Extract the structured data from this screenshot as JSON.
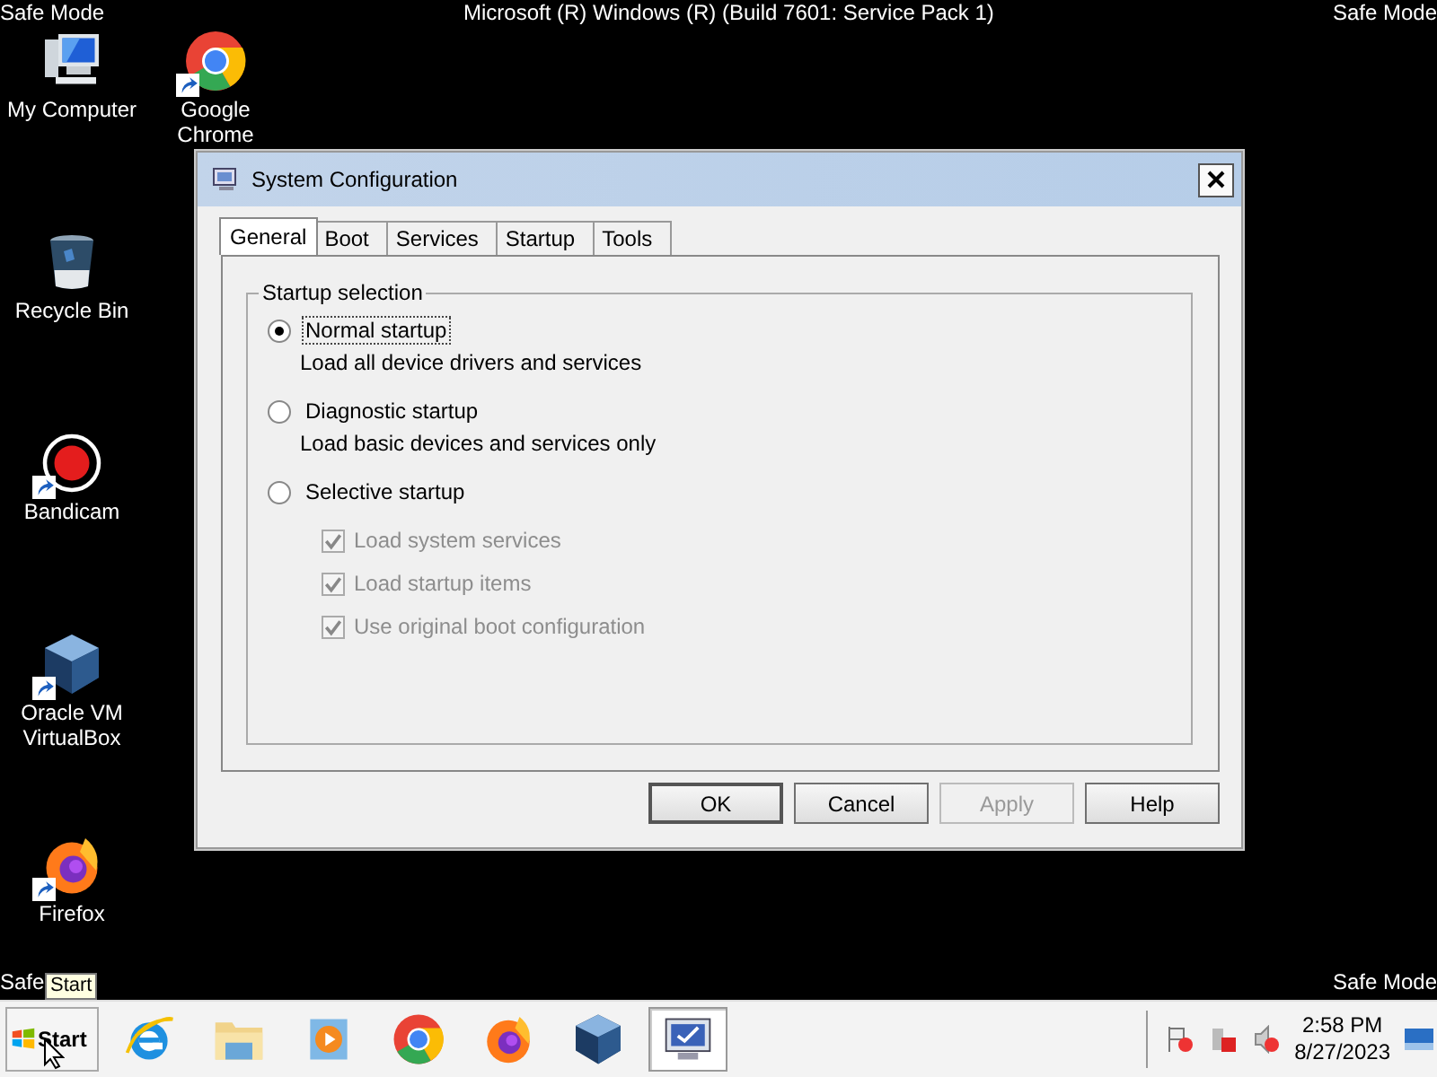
{
  "top_bar": {
    "left": "Safe Mode",
    "center": "Microsoft (R) Windows (R) (Build 7601: Service Pack 1)",
    "right": "Safe Mode"
  },
  "bottom_bar": {
    "left": "Safe",
    "right": "Safe Mode"
  },
  "desktop_icons": [
    {
      "label": "My Computer",
      "kind": "computer",
      "shortcut": false
    },
    {
      "label": "Recycle Bin",
      "kind": "bin",
      "shortcut": false
    },
    {
      "label": "Bandicam",
      "kind": "record",
      "shortcut": true
    },
    {
      "label": "Oracle VM VirtualBox",
      "kind": "cube",
      "shortcut": true
    },
    {
      "label": "Firefox",
      "kind": "firefox",
      "shortcut": true
    },
    {
      "label": "Google Chrome",
      "kind": "chrome",
      "shortcut": true
    }
  ],
  "dialog": {
    "title": "System Configuration",
    "tabs": [
      {
        "label": "General",
        "selected": true
      },
      {
        "label": "Boot",
        "selected": false
      },
      {
        "label": "Services",
        "selected": false
      },
      {
        "label": "Startup",
        "selected": false
      },
      {
        "label": "Tools",
        "selected": false
      }
    ],
    "group_label": "Startup selection",
    "options": [
      {
        "label": "Normal startup",
        "description": "Load all device drivers and services",
        "selected": true
      },
      {
        "label": "Diagnostic startup",
        "description": "Load basic devices and services only",
        "selected": false
      },
      {
        "label": "Selective startup",
        "selected": false
      }
    ],
    "suboptions": [
      {
        "label": "Load system services",
        "checked": true,
        "disabled": true
      },
      {
        "label": "Load startup items",
        "checked": true,
        "disabled": true
      },
      {
        "label": "Use original boot configuration",
        "checked": true,
        "disabled": true
      }
    ],
    "buttons": [
      {
        "label": "OK",
        "disabled": false,
        "default": true
      },
      {
        "label": "Cancel",
        "disabled": false,
        "default": false
      },
      {
        "label": "Apply",
        "disabled": true,
        "default": false
      },
      {
        "label": "Help",
        "disabled": false,
        "default": false
      }
    ]
  },
  "taskbar": {
    "start_label": "Start",
    "tooltip": "Start",
    "apps": [
      {
        "kind": "ie",
        "active": false
      },
      {
        "kind": "folder",
        "active": false
      },
      {
        "kind": "media",
        "active": false
      },
      {
        "kind": "chrome",
        "active": false
      },
      {
        "kind": "firefox",
        "active": false
      },
      {
        "kind": "cube",
        "active": false
      },
      {
        "kind": "monitor",
        "active": true
      }
    ],
    "clock": {
      "time": "2:58 PM",
      "date": "8/27/2023"
    }
  }
}
